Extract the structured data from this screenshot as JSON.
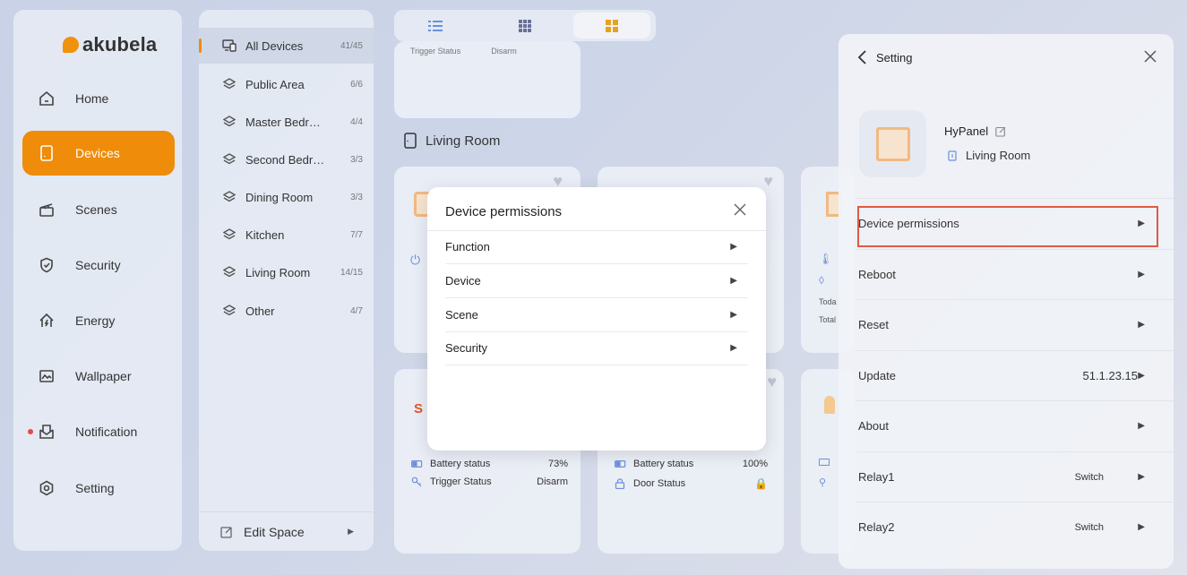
{
  "app": {
    "logo_text": "akubela",
    "brand_color": "#ef8c0a"
  },
  "sidebar": {
    "items": [
      {
        "label": "Home",
        "icon": "home-icon"
      },
      {
        "label": "Devices",
        "icon": "tablet-icon",
        "active": true
      },
      {
        "label": "Scenes",
        "icon": "clapper-icon"
      },
      {
        "label": "Security",
        "icon": "shield-icon"
      },
      {
        "label": "Energy",
        "icon": "energy-icon"
      },
      {
        "label": "Wallpaper",
        "icon": "wallpaper-icon"
      },
      {
        "label": "Notification",
        "icon": "mail-icon",
        "unread_dot": true
      },
      {
        "label": "Setting",
        "icon": "gear-icon"
      }
    ]
  },
  "spaces": {
    "items": [
      {
        "label": "All Devices",
        "count": "41/45",
        "active": true
      },
      {
        "label": "Public Area",
        "count": "6/6"
      },
      {
        "label": "Master Bedr…",
        "count": "4/4"
      },
      {
        "label": "Second Bedr…",
        "count": "3/3"
      },
      {
        "label": "Dining Room",
        "count": "3/3"
      },
      {
        "label": "Kitchen",
        "count": "7/7"
      },
      {
        "label": "Living Room",
        "count": "14/15"
      },
      {
        "label": "Other",
        "count": "4/7"
      }
    ],
    "edit_label": "Edit Space"
  },
  "main": {
    "top_card_trigger_label": "Trigger Status",
    "top_card_trigger_value": "Disarm",
    "section_title": "Living Room",
    "card_a": {
      "battery_label": "Battery status",
      "battery_value": "73%",
      "trigger_label": "Trigger Status",
      "trigger_value": "Disarm",
      "logo_text": "S"
    },
    "card_b": {
      "battery_label": "Battery status",
      "battery_value": "100%",
      "door_label": "Door Status"
    },
    "card_c": {
      "today_label": "Toda",
      "total_label": "Total"
    }
  },
  "modal": {
    "title": "Device permissions",
    "items": [
      "Function",
      "Device",
      "Scene",
      "Security"
    ]
  },
  "setting": {
    "title": "Setting",
    "device_name": "HyPanel",
    "device_room": "Living Room",
    "rows": [
      {
        "label": "Device permissions",
        "value": ""
      },
      {
        "label": "Reboot",
        "value": ""
      },
      {
        "label": "Reset",
        "value": ""
      },
      {
        "label": "Update",
        "value": "51.1.23.15"
      },
      {
        "label": "About",
        "value": ""
      },
      {
        "label": "Relay1",
        "value": "Switch"
      },
      {
        "label": "Relay2",
        "value": "Switch"
      }
    ]
  },
  "colors": {
    "highlight": "#e05a44",
    "device_accent": "#f1b983"
  }
}
